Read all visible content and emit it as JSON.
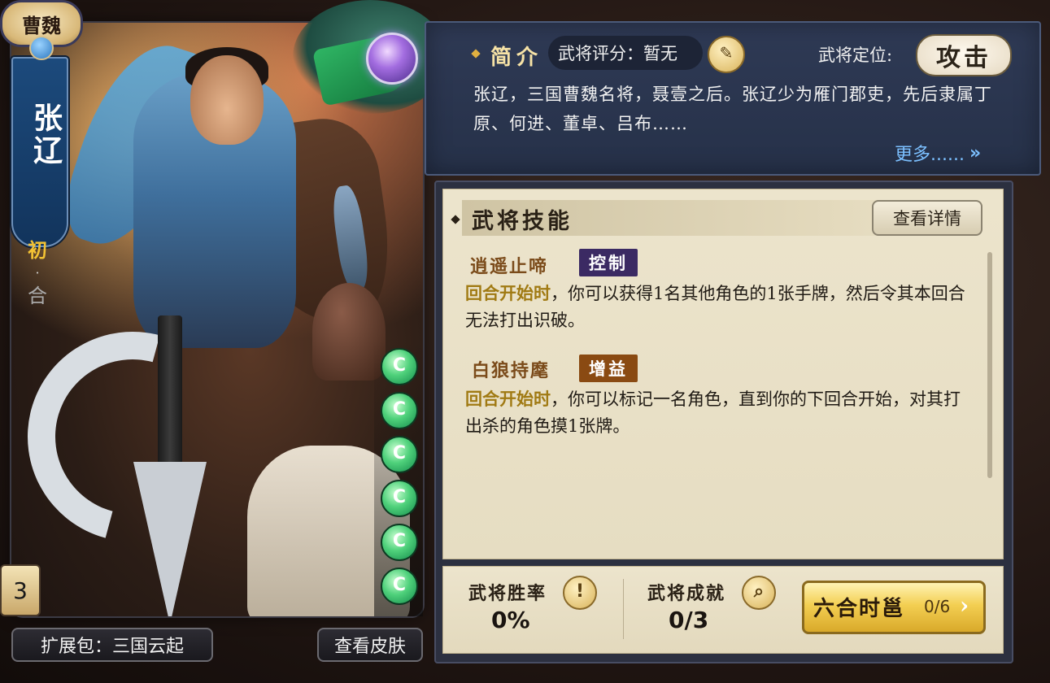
{
  "hero": {
    "kingdom": "曹魏",
    "name": "张辽",
    "tag_primary": "初",
    "tag_dot": "·",
    "tag_secondary": "合",
    "rarity_level": "3",
    "hp_pips": 6,
    "hp_symbol": "C"
  },
  "bottom_left": {
    "expansion_label": "扩展包：三国云起",
    "view_skins_label": "查看皮肤"
  },
  "intro": {
    "title": "简介",
    "rating_label": "武将评分：暂无",
    "rating_icon": "note-icon",
    "role_label": "武将定位:",
    "role_value": "攻击",
    "description": "张辽，三国曹魏名将，聂壹之后。张辽少为雁门郡吏，先后隶属丁原、何进、董卓、吕布……",
    "more_label": "更多......",
    "more_arrow": "»"
  },
  "skills": {
    "title": "武将技能",
    "detail_button": "查看详情",
    "items": [
      {
        "name": "逍遥止啼",
        "tag": "控制",
        "tag_color": "#3b2a63",
        "trigger": "回合开始时",
        "text": "，你可以获得1名其他角色的1张手牌，然后令其本回合无法打出识破。"
      },
      {
        "name": "白狼持麾",
        "tag": "增益",
        "tag_color": "#8a4a12",
        "trigger": "回合开始时",
        "text": "，你可以标记一名角色，直到你的下回合开始，对其打出杀的角色摸1张牌。"
      }
    ]
  },
  "stats": {
    "win_rate_label": "武将胜率",
    "win_rate_icon": "!",
    "win_rate_value": "0%",
    "achievement_label": "武将成就",
    "achievement_icon": "magnifier-icon",
    "achievement_value": "0/3",
    "sixhe_label": "六合时邕",
    "sixhe_count": "0/6",
    "sixhe_arrow": "›"
  },
  "colors": {
    "accent_gold": "#e0b040",
    "keyword_gold": "#a07a13",
    "link_blue": "#7cc0ff",
    "panel_blue": "#2f3a55",
    "parchment": "#ece4cc"
  }
}
